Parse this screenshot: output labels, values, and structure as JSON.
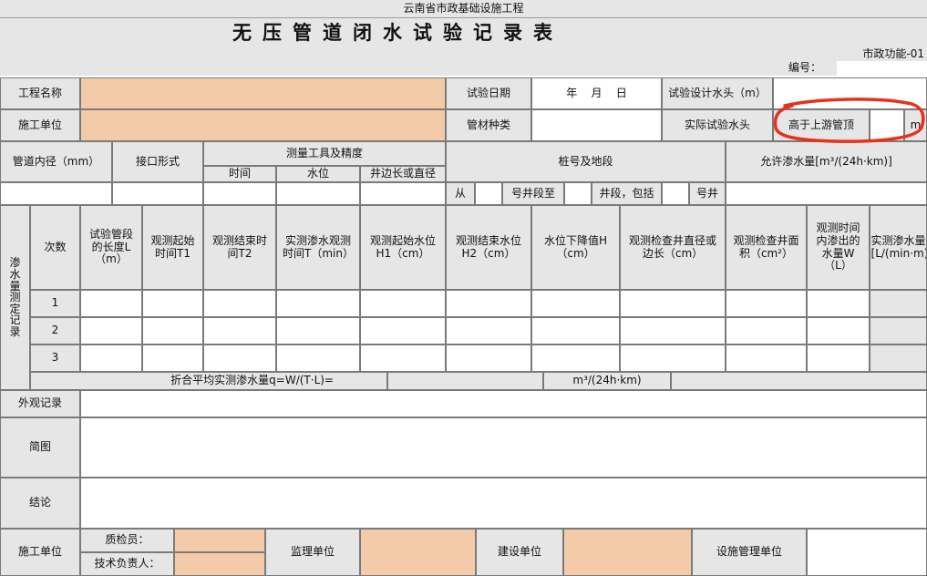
{
  "header": {
    "org": "云南省市政基础设施工程",
    "title": "无压管道闭水试验记录表",
    "form_code": "市政功能-01",
    "serial_label": "编号："
  },
  "info": {
    "project_name": "工程名称",
    "test_date": "试验日期",
    "date_value": "年    月    日",
    "design_head": "试验设计水头（m）",
    "construction_unit": "施工单位",
    "pipe_type": "管材种类",
    "actual_head": "实际试验水头",
    "actual_head_note": "高于上游管顶",
    "actual_head_unit": "m"
  },
  "measure_header": {
    "pipe_diameter": "管道内径（mm）",
    "joint_type": "接口形式",
    "tools": "测量工具及精度",
    "time": "时间",
    "water_level": "水位",
    "well_side": "井边长或直径",
    "station": "桩号及地段",
    "allowable": "允许渗水量[m³/(24h·km)]",
    "from": "从",
    "well_to": "号井段至",
    "well_segment": "井段，包括",
    "well_no": "号井"
  },
  "table": {
    "side_label": "渗水量测定记录",
    "columns": [
      "次数",
      "试验管段的长度L（m）",
      "观测起始时间T1",
      "观测结束时间T2",
      "实测渗水观测时间T（min）",
      "观测起始水位H1（cm）",
      "观测结束水位H2（cm）",
      "水位下降值H（cm）",
      "观测检查井直径或边长（cm）",
      "观测检查井面积（cm²）",
      "观测时间内渗出的水量W（L）",
      "实测渗水量q[L/(min·m)]"
    ],
    "rows": [
      "1",
      "2",
      "3"
    ],
    "avg_label": "折合平均实测渗水量q=W/(T·L)=",
    "avg_unit": "m³/(24h·km)"
  },
  "records": {
    "appearance": "外观记录",
    "sketch": "简图",
    "conclusion": "结论"
  },
  "footer": {
    "construction_unit": "施工单位",
    "qc": "质检员：",
    "tech_lead": "技术负责人：",
    "supervision": "监理单位",
    "owner": "建设单位",
    "facility_mgmt": "设施管理单位"
  },
  "colors": {
    "fill_orange": "#f4cba8",
    "header_gray": "#e6e6e6",
    "annotation_red": "#e8301c"
  }
}
